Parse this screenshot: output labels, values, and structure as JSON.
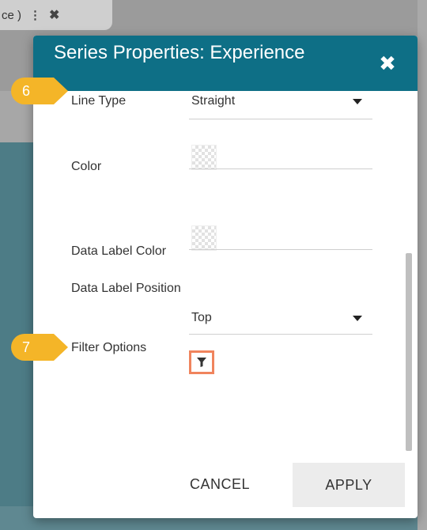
{
  "background": {
    "tab_text": "ce )",
    "menu_icon": "vertical-dots",
    "close_icon": "close"
  },
  "dialog": {
    "title": "Series Properties: Experience",
    "close_icon": "close-x",
    "fields": {
      "line_type": {
        "label": "Line Type",
        "value": "Straight"
      },
      "color": {
        "label": "Color"
      },
      "data_label_color": {
        "label": "Data Label Color"
      },
      "data_label_position": {
        "label": "Data Label Position",
        "value": "Top"
      },
      "filter_options": {
        "label": "Filter Options",
        "icon": "filter-funnel"
      }
    },
    "buttons": {
      "cancel": "CANCEL",
      "apply": "APPLY"
    }
  },
  "callouts": [
    "6",
    "7"
  ],
  "colors": {
    "header": "#0e6f86",
    "callout": "#f4b528",
    "highlight": "#f0845d",
    "apply_bg": "#ececec"
  }
}
